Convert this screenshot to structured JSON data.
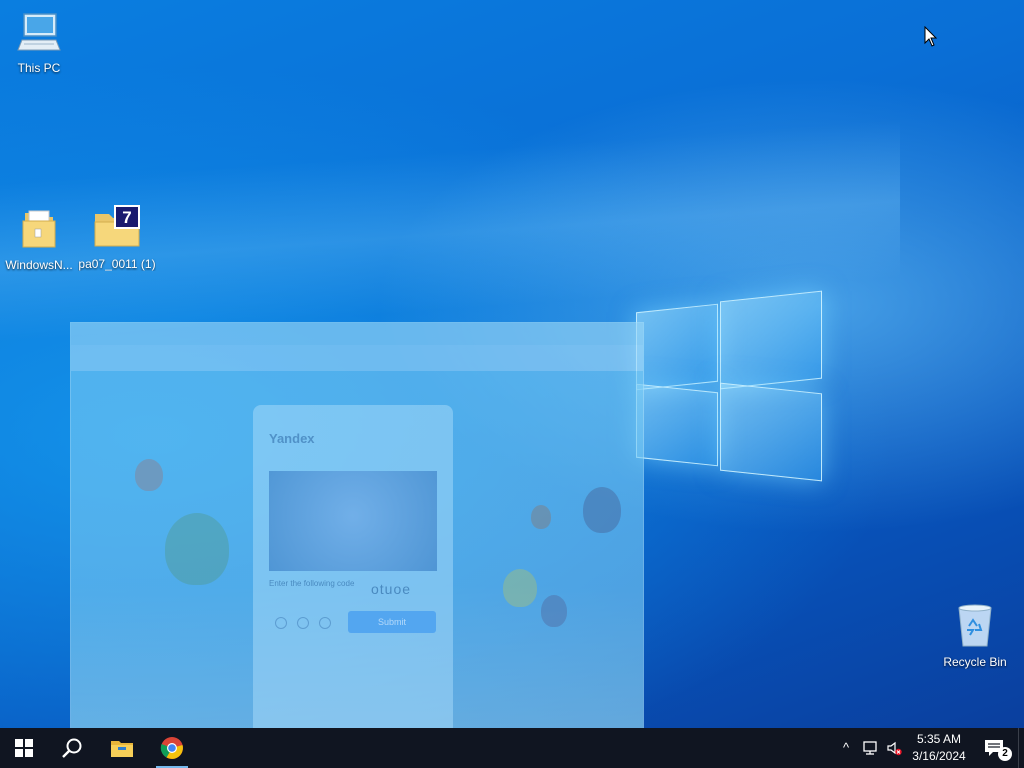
{
  "desktop": {
    "icons": [
      {
        "label": "This PC",
        "icon": "this-pc-icon"
      },
      {
        "label": "WindowsN...",
        "icon": "folder-icon"
      },
      {
        "label": "pa07_0011 (1)",
        "icon": "help-file-icon"
      },
      {
        "label": "Recycle Bin",
        "icon": "recycle-bin-icon"
      }
    ]
  },
  "ghost_window": {
    "tabs": [
      "",
      ""
    ],
    "captcha": {
      "brand": "Yandex",
      "prompt": "Enter the following code",
      "code": "otuoe",
      "submit": "Submit",
      "hint": "",
      "left_text": "",
      "right_text": ""
    }
  },
  "taskbar": {
    "start": "windows-start-icon",
    "search": "search-icon",
    "apps": [
      "file-explorer-icon",
      "chrome-icon"
    ],
    "tray": {
      "chevron": "^",
      "time": "5:35 AM",
      "date": "3/16/2024",
      "notification_count": "2"
    }
  },
  "colors": {
    "taskbar": "#101521",
    "accent": "#76b9ed"
  }
}
